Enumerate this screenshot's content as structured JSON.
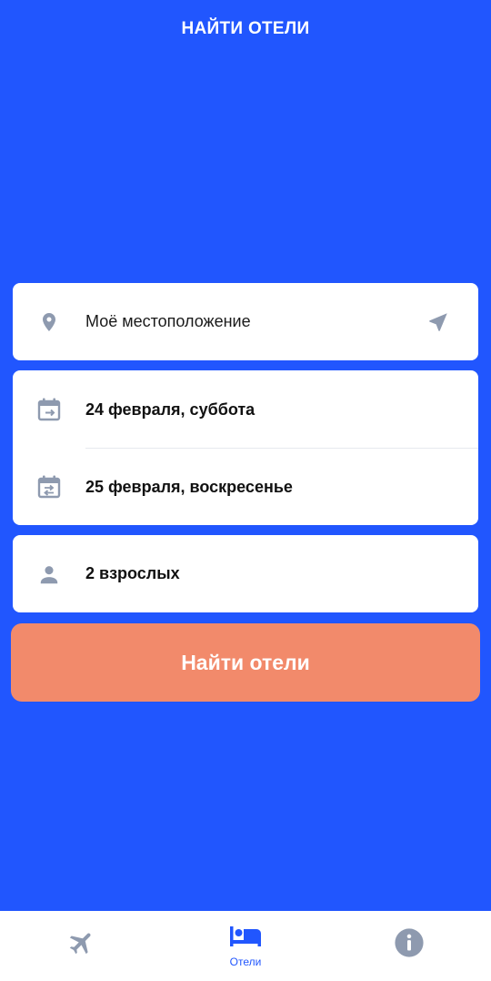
{
  "header": {
    "title": "НАЙТИ ОТЕЛИ"
  },
  "location": {
    "label": "Моё местоположение"
  },
  "dates": {
    "check_in": "24 февраля, суббота",
    "check_out": "25 февраля, воскресенье"
  },
  "guests": {
    "label": "2 взрослых"
  },
  "search_button": {
    "label": "Найти отели"
  },
  "bottom_nav": {
    "items": [
      {
        "icon": "airplane-icon",
        "label": ""
      },
      {
        "icon": "bed-icon",
        "label": "Отели"
      },
      {
        "icon": "info-icon",
        "label": ""
      }
    ]
  },
  "colors": {
    "background": "#2156FE",
    "button": "#F28A6B",
    "icon": "#8E9AAF",
    "active_nav": "#2156FE"
  }
}
